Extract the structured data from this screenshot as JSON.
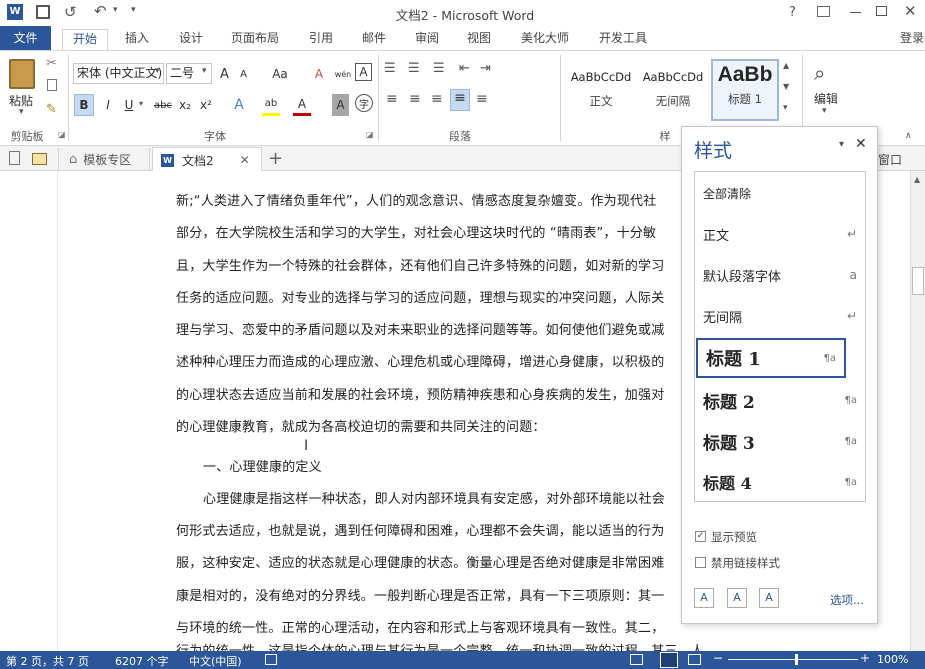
{
  "title": {
    "doc_name": "文档2 - Microsoft Word",
    "help": "?",
    "signin": "登录"
  },
  "menu": {
    "file": "文件",
    "tabs": [
      "开始",
      "插入",
      "设计",
      "页面布局",
      "引用",
      "邮件",
      "审阅",
      "视图",
      "美化大师",
      "开发工具"
    ]
  },
  "ribbon": {
    "paste": "粘贴",
    "clipboard": "剪贴板",
    "font_name": "宋体 (中文正文)",
    "font_size": "二号",
    "font_group": "字体",
    "para_group": "段落",
    "styles_group_partial": "样",
    "editing": "编辑",
    "gallery": [
      {
        "preview": "AaBbCcDd",
        "name": "正文"
      },
      {
        "preview": "AaBbCcDd",
        "name": "无间隔"
      },
      {
        "preview": "AaBb",
        "name": "标题 1"
      }
    ],
    "font_buttons": {
      "grow": "A",
      "shrink": "A",
      "case": "Aa",
      "clear": "A",
      "phonetic": "wén",
      "border": "A",
      "bold": "B",
      "italic": "I",
      "underline": "U",
      "strike": "abc",
      "sub": "x₂",
      "sup": "x²",
      "effects": "A",
      "highlight": "ab",
      "color": "A",
      "shade": "A",
      "circle": "字"
    }
  },
  "doctabs": {
    "template": "模板专区",
    "doc": "文档2",
    "window_partial": "窗口"
  },
  "document": {
    "lines": [
      "新;“人类进入了情绪负重年代”，人们的观念意识、情感态度复杂嬗变。作为现代社",
      "部分，在大学院校生活和学习的大学生，对社会心理这块时代的 “晴雨表”，十分敏",
      "且，大学生作为一个特殊的社会群体，还有他们自己许多特殊的问题，如对新的学习",
      "任务的适应问题。对专业的选择与学习的适应问题，理想与现实的冲突问题，人际关",
      "理与学习、恋爱中的矛盾问题以及对未来职业的选择问题等等。如何使他们避免或减",
      "述种种心理压力而造成的心理应激、心理危机或心理障碍，增进心身健康，以积极的",
      "的心理状态去适应当前和发展的社会环境，预防精神疾患和心身疾病的发生，加强对",
      "的心理健康教育，就成为各高校迫切的需要和共同关注的问题："
    ],
    "heading": "一、心理健康的定义",
    "lines2": [
      "心理健康是指这样一种状态，即人对内部环境具有安定感，对外部环境能以社会",
      "何形式去适应，也就是说，遇到任何障碍和困难，心理都不会失调，能以适当的行为",
      "服，这种安定、适应的状态就是心理健康的状态。衡量心理是否绝对健康是非常困难",
      "康是相对的，没有绝对的分界线。一般判断心理是否正常，具有一下三项原则：其一",
      "与环境的统一性。正常的心理活动，在内容和形式上与客观环境具有一致性。其二，",
      "行为的统一性，这是指个体的心理与其行为是一个完整、统一和协调一致的过程。其三，人"
    ]
  },
  "styles_pane": {
    "title": "样式",
    "items": [
      {
        "label": "全部清除",
        "mark": ""
      },
      {
        "label": "正文",
        "mark": "↵"
      },
      {
        "label": "默认段落字体",
        "mark": "a"
      },
      {
        "label": "无间隔",
        "mark": "↵"
      },
      {
        "label": "标题 1",
        "mark": "¶a"
      },
      {
        "label": "标题 2",
        "mark": "¶a"
      },
      {
        "label": "标题 3",
        "mark": "¶a"
      },
      {
        "label": "标题 4",
        "mark": "¶a"
      }
    ],
    "show_preview": "显示预览",
    "disable_linked": "禁用链接样式",
    "options": "选项..."
  },
  "status": {
    "page": "第 2 页，共 7 页",
    "words": "6207 个字",
    "lang": "中文(中国)",
    "zoom": "100%"
  },
  "colors": {
    "accent": "#2b579a"
  }
}
